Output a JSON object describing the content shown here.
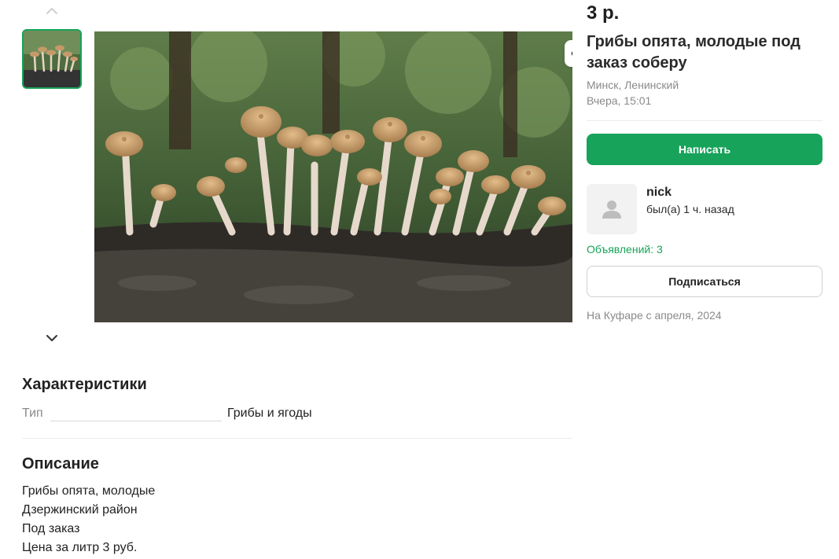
{
  "listing": {
    "price": "3 р.",
    "title": "Грибы опята, молодые под заказ соберу",
    "location": "Минск, Ленинский",
    "date": "Вчера, 15:01"
  },
  "actions": {
    "write_label": "Написать",
    "subscribe_label": "Подписаться",
    "icons": [
      "share-icon",
      "heart-icon",
      "warning-icon"
    ]
  },
  "seller": {
    "name": "nick",
    "last_seen": "был(а) 1 ч. назад",
    "ads_count": "Объявлений: 3",
    "since": "На Куфаре с апреля, 2024"
  },
  "specs": {
    "heading": "Характеристики",
    "items": [
      {
        "label": "Тип",
        "value": "Грибы и ягоды"
      }
    ]
  },
  "description": {
    "heading": "Описание",
    "lines": [
      "Грибы опята, молодые",
      "Дзержинский район",
      "Под заказ",
      "Цена за литр 3 руб."
    ]
  },
  "colors": {
    "accent": "#17a35a",
    "muted": "#8a8a8a"
  }
}
